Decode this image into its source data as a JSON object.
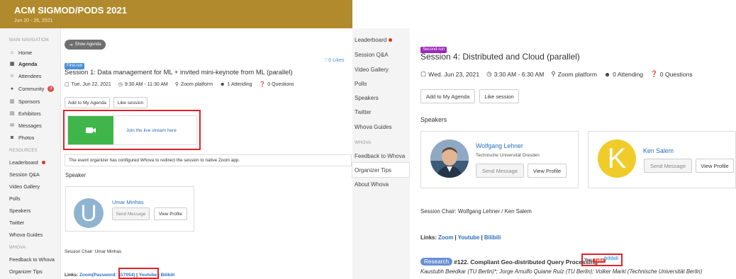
{
  "left": {
    "conference": {
      "title": "ACM SIGMOD/PODS 2021",
      "dates": "Jun 20 - 26, 2021"
    },
    "sidebar": {
      "main_heading": "MAIN NAVIGATION",
      "main_items": [
        {
          "label": "Home",
          "icon": "home-icon"
        },
        {
          "label": "Agenda",
          "icon": "calendar-icon"
        },
        {
          "label": "Attendees",
          "icon": "people-icon"
        },
        {
          "label": "Community",
          "icon": "chat-icon",
          "badge": "3"
        },
        {
          "label": "Sponsors",
          "icon": "building-icon"
        },
        {
          "label": "Exhibitors",
          "icon": "exhibitor-icon"
        },
        {
          "label": "Messages",
          "icon": "envelope-icon"
        },
        {
          "label": "Photos",
          "icon": "camera-icon"
        }
      ],
      "resources_heading": "RESOURCES",
      "resource_items": [
        "Leaderboard",
        "Session Q&A",
        "Video Gallery",
        "Polls",
        "Speakers",
        "Twitter",
        "Whova Guides"
      ],
      "whova_heading": "WHOVA",
      "whova_items": [
        "Feedback to Whova",
        "Organizer Tips"
      ]
    },
    "show_agenda": "Show Agenda",
    "session": {
      "run_tag": "First-run",
      "likes": "0 Likes",
      "title": "Session 1: Data management for ML + invited mini-keynote from ML (parallel)",
      "date": "Tue. Jun 22, 2021",
      "time": "9:30 AM - 11:30 AM",
      "location": "Zoom platform",
      "attending": "1 Attending",
      "questions": "0 Questions",
      "add_agenda": "Add to My Agenda",
      "like": "Like session",
      "livestream": "Join the live stream here",
      "notice": "The event organizer has configured Whova to redirect the session to native Zoom app.",
      "speaker_heading": "Speaker",
      "speaker": {
        "initial": "U",
        "name": "Umar Minhas",
        "send": "Send Message",
        "view": "View Profile"
      },
      "chair": "Session Chair: Umar Minhas",
      "links_label": "Links: ",
      "link_zoom": "Zoom",
      "link_password": "(Password: 417054)",
      "link_youtube": "Youtube",
      "link_bilibili": "Bilibili"
    }
  },
  "right": {
    "sidebar": {
      "items": [
        "Leaderboard",
        "Session Q&A",
        "Video Gallery",
        "Polls",
        "Speakers",
        "Twitter",
        "Whova Guides"
      ],
      "whova_heading": "WHOVA",
      "whova_items": [
        "Feedback to Whova",
        "Organizer Tips",
        "About Whova"
      ]
    },
    "session": {
      "run_tag": "Second-run",
      "title": "Session 4: Distributed and Cloud (parallel)",
      "date": "Wed. Jun 23, 2021",
      "time": "3:30 AM - 6:30 AM",
      "location": "Zoom platform",
      "attending": "0 Attending",
      "questions": "0 Questions",
      "add_agenda": "Add to My Agenda",
      "like": "Like session",
      "speakers_heading": "Speakers",
      "speakers": [
        {
          "name": "Wolfgang Lehner",
          "affiliation": "Technische Universität Dresden",
          "send": "Send Message",
          "view": "View Profile"
        },
        {
          "name": "Ken Salem",
          "initial": "K",
          "send": "Send Message",
          "view": "View Profile"
        }
      ],
      "chair": "Session Chair: Wolfgang Lehner / Ken Salem",
      "links_label": "Links: ",
      "link_zoom": "Zoom",
      "link_youtube": "Youtube",
      "link_bilibili": "Bilibili",
      "paper": {
        "tag": "Research",
        "title": "#122. Compliant Geo-distributed Query Processing",
        "youtube_logo": "You",
        "youtube_logo_tube": "Tube",
        "bilibili_logo": "bilibili",
        "authors": "Kaustubh Beedkar (TU Berlin)*; Jorge Arnulfo Quiane Ruiz (TU Berlin); Volker Markl (Technische Universität Berlin)"
      }
    }
  }
}
